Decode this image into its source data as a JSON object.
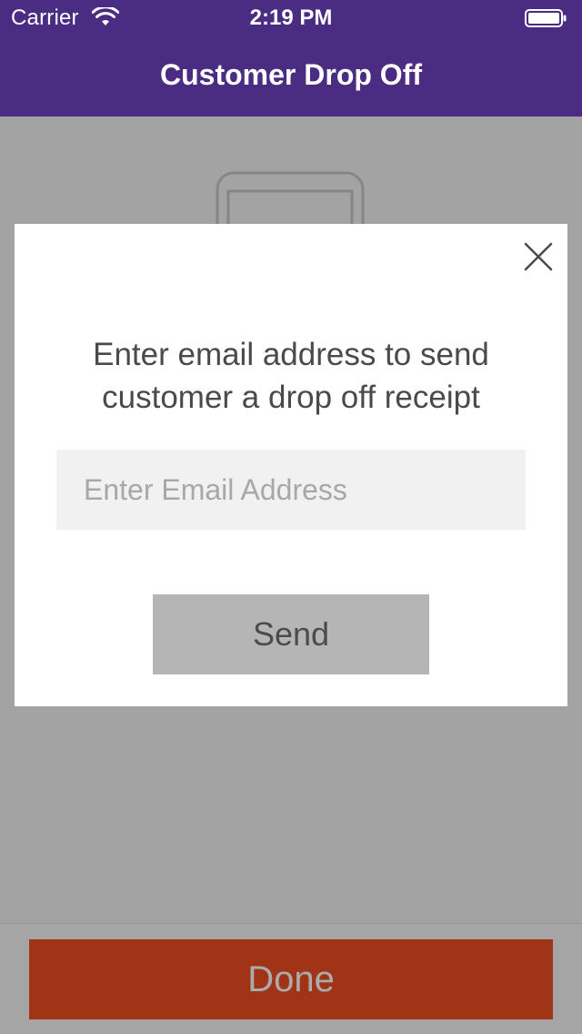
{
  "status_bar": {
    "carrier": "Carrier",
    "time": "2:19 PM",
    "wifi_icon": "wifi-icon",
    "battery_icon": "battery-icon"
  },
  "header": {
    "title": "Customer Drop Off"
  },
  "modal": {
    "close_icon": "close-icon",
    "message": "Enter email address to send customer a drop off receipt",
    "email_input": {
      "value": "",
      "placeholder": "Enter Email Address"
    },
    "send_label": "Send"
  },
  "footer": {
    "done_label": "Done"
  },
  "colors": {
    "header_background": "#4a2c82",
    "done_button": "#f04e23",
    "send_button": "#b5b5b5",
    "input_background": "#f1f1f1"
  }
}
